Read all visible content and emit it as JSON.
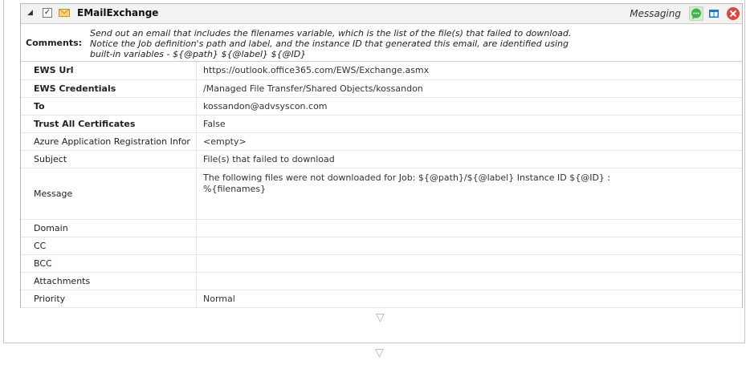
{
  "task": {
    "title": "EMailExchange",
    "category": "Messaging",
    "checkbox_mark": "✓",
    "collapse_glyph": "◢"
  },
  "comments": {
    "label": "Comments:",
    "lines": [
      "Send out an email that includes the filenames variable, which is the list of the file(s) that failed to download.",
      "Notice the Job definition's path and label, and the instance ID that generated this email, are identified using",
      "built-in variables - ${@path} ${@label} ${@ID}"
    ]
  },
  "properties": [
    {
      "name": "EWS Url",
      "value": "https://outlook.office365.com/EWS/Exchange.asmx",
      "bold": true
    },
    {
      "name": "EWS Credentials",
      "value": "/Managed File Transfer/Shared Objects/kossandon",
      "bold": true
    },
    {
      "name": "To",
      "value": "kossandon@advsyscon.com",
      "bold": true
    },
    {
      "name": "Trust All Certificates",
      "value": "False",
      "bold": true
    },
    {
      "name": "Azure Application Registration Infor",
      "value": "<empty>",
      "bold": false
    },
    {
      "name": "Subject",
      "value": "File(s) that failed to download",
      "bold": false
    },
    {
      "name": "Message",
      "value_lines": [
        "The following files were not downloaded for Job: ${@path}/${@label} Instance ID ${@ID} :",
        "%{filenames}"
      ],
      "bold": false
    },
    {
      "name": "Domain",
      "value": "",
      "bold": false
    },
    {
      "name": "CC",
      "value": "",
      "bold": false
    },
    {
      "name": "BCC",
      "value": "",
      "bold": false
    },
    {
      "name": "Attachments",
      "value": "",
      "bold": false
    },
    {
      "name": "Priority",
      "value": "Normal",
      "bold": false
    }
  ],
  "connector_glyph": "▽",
  "colors": {
    "comment_button": "#3cb44b",
    "layout_button": "#1e78c8",
    "close_button": "#e0443a",
    "envelope": "#e8b030"
  }
}
